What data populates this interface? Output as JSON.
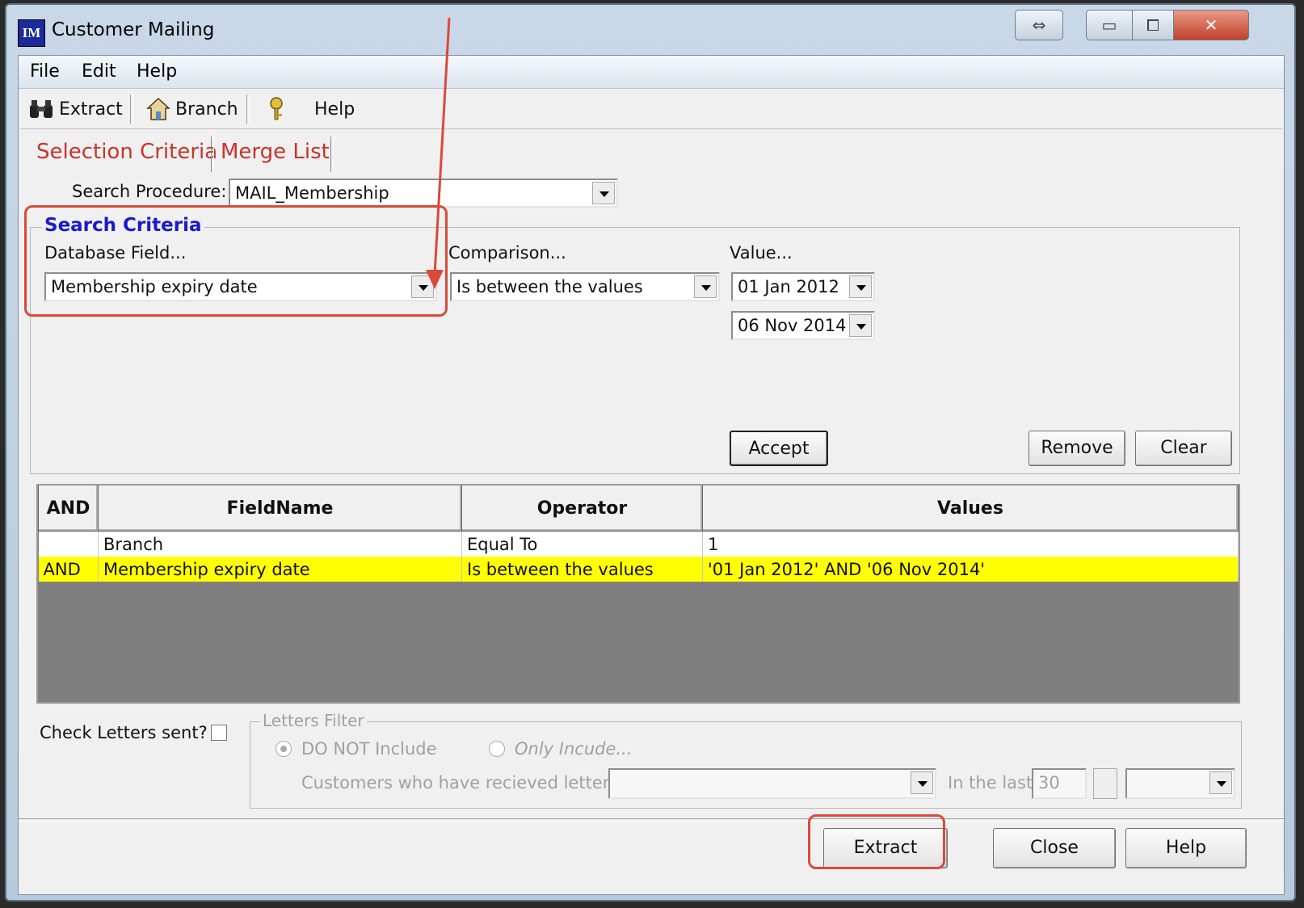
{
  "window": {
    "title": "Customer Mailing",
    "icon_text": "IM",
    "buttons": {
      "restore_glyph": "⇔",
      "minimize_glyph": "▭",
      "maximize_glyph": "⧠",
      "close_glyph": "✕"
    }
  },
  "menu": [
    "File",
    "Edit",
    "Help"
  ],
  "toolbar": {
    "extract": "Extract",
    "branch": "Branch",
    "help": "Help"
  },
  "tabs": [
    "Selection Criteria",
    "Merge List"
  ],
  "search_procedure": {
    "label": "Search Procedure:",
    "value": "MAIL_Membership"
  },
  "criteria": {
    "title": "Search Criteria",
    "field_label": "Database Field...",
    "field_value": "Membership expiry date",
    "comparison_label": "Comparison...",
    "comparison_value": "Is between the values",
    "value_label": "Value...",
    "value1": "01 Jan  2012",
    "value2": "06 Nov 2014",
    "accept": "Accept",
    "remove": "Remove",
    "clear": "Clear"
  },
  "grid": {
    "headers": [
      "AND",
      "FieldName",
      "Operator",
      "Values"
    ],
    "rows": [
      {
        "and": "",
        "field": "Branch",
        "operator": "Equal To",
        "values": "1"
      },
      {
        "and": "AND",
        "field": "Membership expiry date",
        "operator": "Is between the values",
        "values": "'01 Jan 2012'  AND '06 Nov 2014'"
      }
    ]
  },
  "letters": {
    "check_label": "Check Letters sent?",
    "filter_title": "Letters Filter",
    "do_not_include": "DO NOT Include",
    "only_include": "Only Incude...",
    "received_label": "Customers who have recieved letter...",
    "in_last_label": "In the last",
    "in_last_value": "30"
  },
  "footer": {
    "extract": "Extract",
    "close": "Close",
    "help": "Help"
  },
  "colors": {
    "highlight": "#d94a3a",
    "tab_text": "#c8342a",
    "group_title": "#1a1acc",
    "selected_row": "#ffff00"
  }
}
